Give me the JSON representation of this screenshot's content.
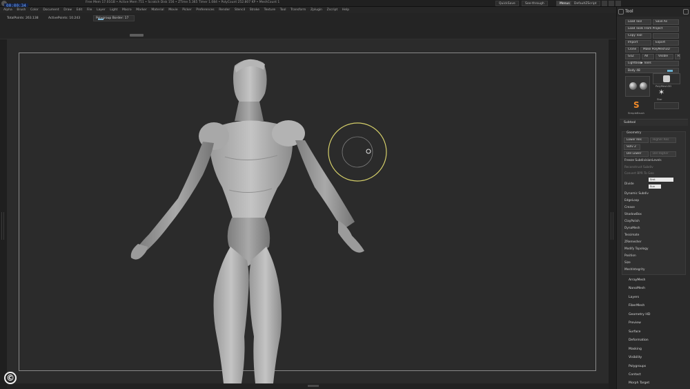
{
  "titlebar": {
    "time_display": "00:00:34",
    "info_text": "Free Mem 17.01GB • Active Mem 751 • Scratch Disk 156 • ZTime 5.365 Timer 1.084 • PolyCount 252.807 KP • MeshCount 1",
    "buttons": [
      {
        "label": "QuickSave"
      },
      {
        "label": "See-through"
      },
      {
        "label": "Menus"
      },
      {
        "label": "DefaultZScript"
      }
    ]
  },
  "menubar": {
    "items": [
      "Alpha",
      "Brush",
      "Color",
      "Document",
      "Draw",
      "Edit",
      "File",
      "Layer",
      "Light",
      "Macro",
      "Marker",
      "Material",
      "Movie",
      "Picker",
      "Preferences",
      "Render",
      "Stencil",
      "Stroke",
      "Texture",
      "Tool",
      "Transform",
      "Zplugin",
      "Zscript",
      "Help"
    ]
  },
  "infobar": {
    "total_points": "TotalPoints: 263.138",
    "active_points": "ActivePoints: 10.243",
    "polypaint_label": "Polygroup Border: 17"
  },
  "tool_palette": {
    "title": "Tool",
    "buttons": {
      "load_tool": "Load Tool",
      "save_as": "Save As",
      "load_from_project": "Load Tools From Project",
      "copy_tool": "Copy Tool",
      "paste_tool": "",
      "import": "Import",
      "export": "Export",
      "clone": "Clone",
      "make_polymesh": "Make PolyMesh3D",
      "goz": "GoZ",
      "all": "All",
      "visible": "Visible",
      "r": "R",
      "lightbox_tools": "Lightbox▶ Tools"
    },
    "slider": {
      "label": "Body 48"
    },
    "thumbs": {
      "simple_brush": "SimpleBrush",
      "polymesh": "PolyMesh3D",
      "star": "Star",
      "default_caption": "SimpleBrush"
    },
    "subtool_header": "Subtool",
    "geometry_header": "Geometry",
    "geometry": {
      "lower_res": "Lower Res",
      "higher_res": "Higher Res",
      "sdiv": "SDiv 2",
      "del_lower": "Del Lower",
      "del_higher": "Del Higher",
      "freeze_subdivision": "Freeze SubdivisionLevels",
      "reconstruct": "Reconstruct Subdiv",
      "convert_bpr": "Convert BPR To Geo",
      "divide": "Divide",
      "smt": "Smt",
      "suv": "Suv"
    },
    "geometry_items": [
      "Dynamic Subdiv",
      "EdgeLoop",
      "Crease",
      "ShadowBox",
      "ClayPolish",
      "DynaMesh",
      "Tessimate",
      "ZRemesher",
      "Modify Topology",
      "Position",
      "Size",
      "MeshIntegrity"
    ],
    "tool_items": [
      "ArrayMesh",
      "NanoMesh",
      "Layers",
      "FiberMesh",
      "Geometry HD",
      "Preview",
      "Surface",
      "Deformation",
      "Masking",
      "Visibility",
      "Polygroups",
      "Contact",
      "Morph Target"
    ]
  },
  "canvas": {
    "brush_ring_color": "#d6d06a",
    "background": "#2b2b2b"
  },
  "watermark": {
    "symbol": "©"
  }
}
